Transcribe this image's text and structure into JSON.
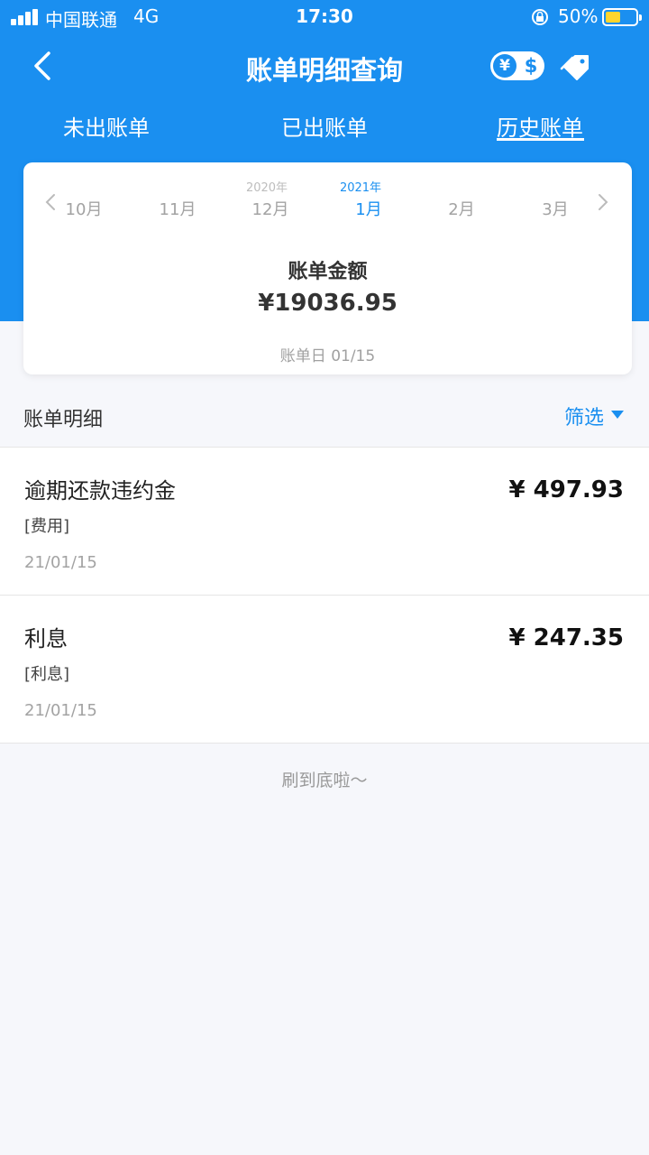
{
  "status_bar": {
    "carrier": "中国联通",
    "network": "4G",
    "time": "17:30",
    "battery_percent": "50%",
    "battery_level": 0.5
  },
  "nav": {
    "title": "账单明细查询",
    "currency_yen": "¥",
    "currency_dollar": "$"
  },
  "tabs": [
    {
      "label": "未出账单",
      "active": false
    },
    {
      "label": "已出账单",
      "active": false
    },
    {
      "label": "历史账单",
      "active": true
    }
  ],
  "month_picker": {
    "months": [
      "10月",
      "11月",
      "12月",
      "1月",
      "2月",
      "3月"
    ],
    "years": [
      "2020年",
      "2021年"
    ],
    "selected": "1月"
  },
  "bill": {
    "amount_label": "账单金额",
    "amount": "¥19036.95",
    "bill_day": "账单日 01/15"
  },
  "details": {
    "title": "账单明细",
    "filter_label": "筛选",
    "items": [
      {
        "name": "逾期还款违约金",
        "category": "[费用]",
        "date": "21/01/15",
        "amount": "¥ 497.93"
      },
      {
        "name": "利息",
        "category": "[利息]",
        "date": "21/01/15",
        "amount": "¥ 247.35"
      }
    ]
  },
  "end_text": "刷到底啦～",
  "colors": {
    "primary": "#1a8ff0",
    "battery": "#ffd52e",
    "background": "#f6f7fb"
  },
  "icons": [
    "signal-icon",
    "lock-rotation-icon",
    "battery-icon",
    "back-arrow-icon",
    "currency-toggle-icon",
    "tag-icon",
    "chevron-left-icon",
    "chevron-right-icon",
    "caret-down-icon"
  ]
}
